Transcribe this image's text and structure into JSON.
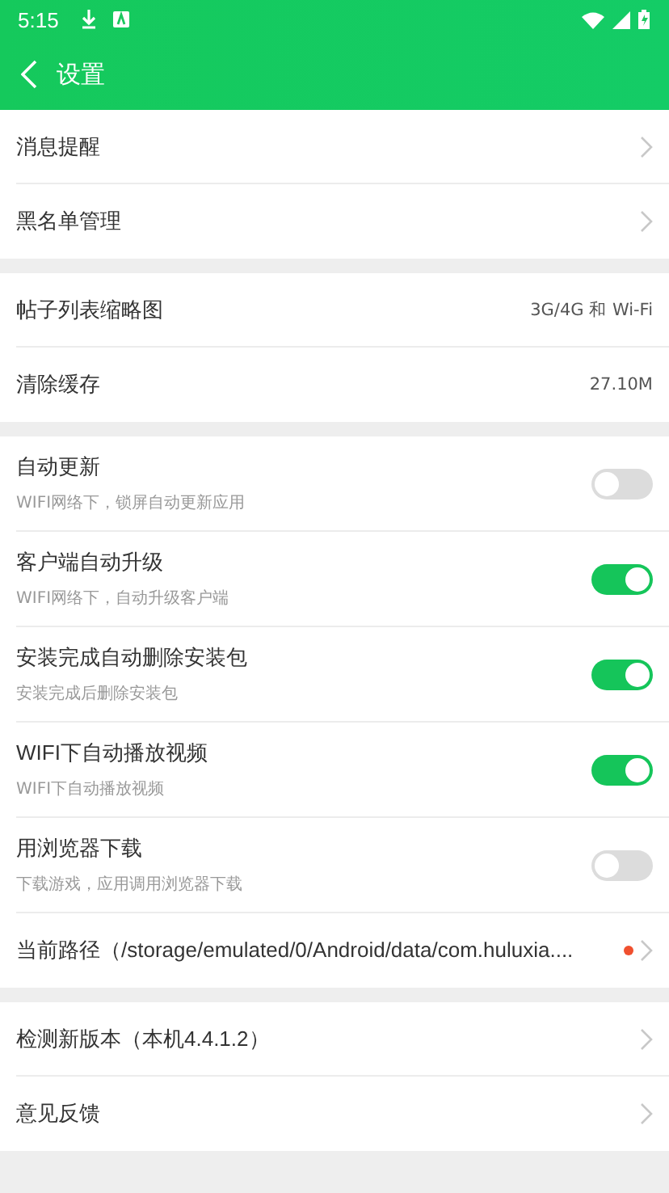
{
  "status_bar": {
    "time": "5:15"
  },
  "app_bar": {
    "title": "设置"
  },
  "sections": [
    {
      "rows": [
        {
          "kind": "nav",
          "label": "消息提醒"
        },
        {
          "kind": "nav",
          "label": "黑名单管理"
        }
      ]
    },
    {
      "rows": [
        {
          "kind": "value",
          "label": "帖子列表缩略图",
          "value": "3G/4G 和 Wi-Fi"
        },
        {
          "kind": "value",
          "label": "清除缓存",
          "value": "27.10M"
        }
      ]
    },
    {
      "rows": [
        {
          "kind": "toggle",
          "label": "自动更新",
          "description": "WIFI网络下，锁屏自动更新应用",
          "on": false
        },
        {
          "kind": "toggle",
          "label": "客户端自动升级",
          "description": "WIFI网络下，自动升级客户端",
          "on": true
        },
        {
          "kind": "toggle",
          "label": "安装完成自动删除安装包",
          "description": "安装完成后删除安装包",
          "on": true
        },
        {
          "kind": "toggle",
          "label": "WIFI下自动播放视频",
          "description": "WIFI下自动播放视频",
          "on": true
        },
        {
          "kind": "toggle",
          "label": "用浏览器下载",
          "description": "下载游戏，应用调用浏览器下载",
          "on": false
        },
        {
          "kind": "nav",
          "label": "当前路径（/storage/emulated/0/Android/data/com.huluxia....",
          "new_badge": true
        }
      ]
    },
    {
      "rows": [
        {
          "kind": "nav",
          "label": "检测新版本（本机4.4.1.2）"
        },
        {
          "kind": "nav",
          "label": "意见反馈"
        }
      ]
    }
  ]
}
